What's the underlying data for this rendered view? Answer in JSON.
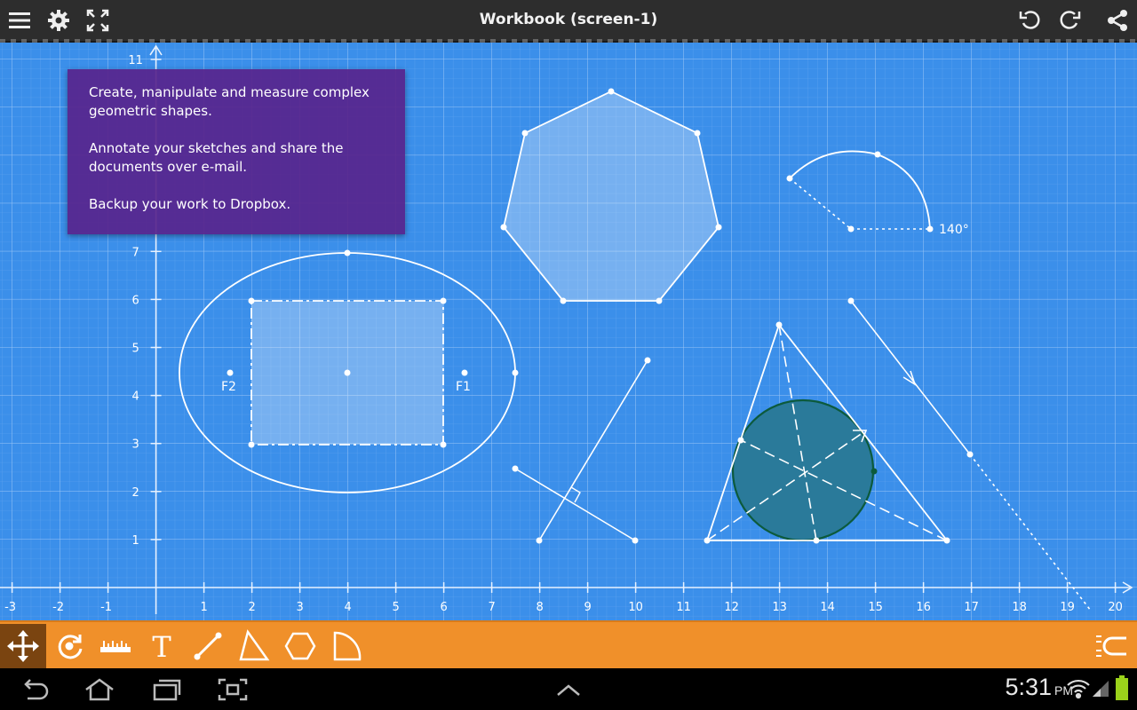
{
  "app": {
    "title": "Workbook (screen-1)"
  },
  "topbar": {
    "left_icons": [
      "menu-icon",
      "settings-gear-icon",
      "fullscreen-icon"
    ],
    "right_icons": [
      "undo-icon",
      "redo-icon",
      "share-icon"
    ]
  },
  "info_panel": {
    "line1": "Create, manipulate and measure complex geometric shapes.",
    "line2": "Annotate your sketches and share the documents over e-mail.",
    "line3": "Backup your work to Dropbox."
  },
  "canvas": {
    "background_color": "#3b8fea",
    "x_ticks": [
      "-3",
      "-2",
      "-1",
      "1",
      "2",
      "3",
      "4",
      "5",
      "6",
      "7",
      "8",
      "9",
      "10",
      "11",
      "12",
      "13",
      "14",
      "15",
      "16",
      "17",
      "18",
      "19",
      "20"
    ],
    "y_ticks": [
      "1",
      "2",
      "3",
      "4",
      "5",
      "6",
      "7",
      "11"
    ],
    "focus_labels": [
      "F2",
      "F1"
    ],
    "angle_label": "140°"
  },
  "toolbar": {
    "tools": [
      "move-tool-icon",
      "rotate-tool-icon",
      "ruler-tool-icon",
      "text-tool-icon",
      "line-tool-icon",
      "triangle-tool-icon",
      "polygon-tool-icon",
      "arc-tool-icon"
    ],
    "active_tool": "move-tool-icon",
    "right_icon": "snap-magnet-icon"
  },
  "navbar": {
    "icons": [
      "back-icon",
      "home-icon",
      "recent-apps-icon",
      "screenshot-icon",
      "up-chevron-icon"
    ],
    "time": "5:31",
    "ampm": "PM",
    "status_icons": [
      "wifi-icon",
      "signal-icon",
      "battery-icon"
    ]
  }
}
